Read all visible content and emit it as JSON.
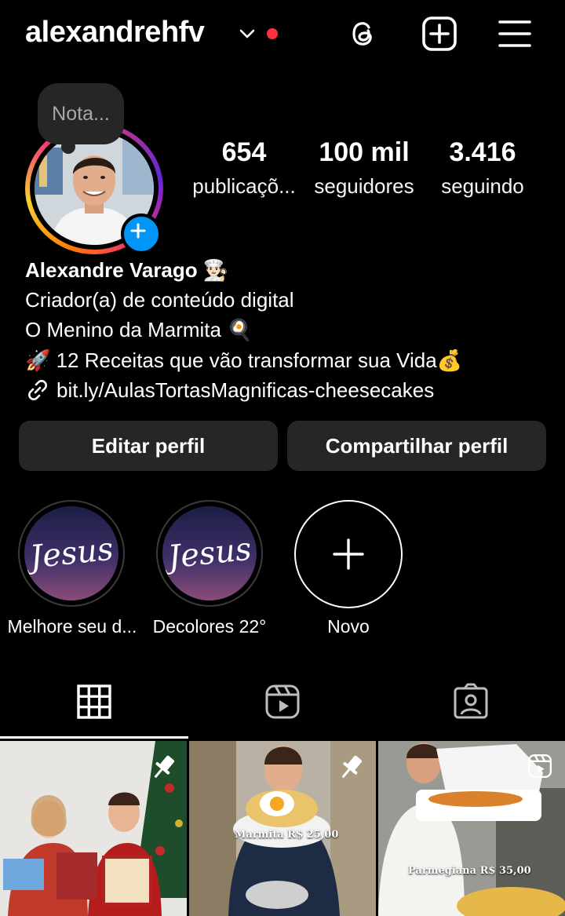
{
  "header": {
    "username": "alexandrehfv",
    "icons": [
      "chevron-down-icon",
      "threads-icon",
      "new-post-icon",
      "menu-icon"
    ]
  },
  "note": {
    "text": "Nota..."
  },
  "stats": [
    {
      "value": "654",
      "label": "publicaçõ..."
    },
    {
      "value": "100 mil",
      "label": "seguidores"
    },
    {
      "value": "3.416",
      "label": "seguindo"
    }
  ],
  "bio": {
    "name": "Alexandre Varago 👨🏻‍🍳",
    "category": "Criador(a) de conteúdo digital",
    "line1": "O Menino da Marmita 🍳",
    "line2": "🚀 12 Receitas que vão transformar sua Vida💰",
    "link": "bit.ly/AulasTortasMagnificas-cheesecakes"
  },
  "buttons": {
    "edit": "Editar perfil",
    "share": "Compartilhar perfil"
  },
  "highlights": [
    {
      "label": "Melhore seu d...",
      "cover_text": "Jesus"
    },
    {
      "label": "Decolores 22°",
      "cover_text": "Jesus"
    },
    {
      "label": "Novo"
    }
  ],
  "tabs": [
    "grid-icon",
    "reels-icon",
    "tagged-icon"
  ],
  "posts": [
    {
      "overlay": "",
      "badge": "pin-icon"
    },
    {
      "overlay": "Marmita R$ 25,00",
      "badge": "pin-icon"
    },
    {
      "overlay": "Parmegiana R$ 35,00",
      "badge": "reels-icon"
    }
  ],
  "colors": {
    "accent": "#0095f6",
    "notification": "#ff3040",
    "button_bg": "#262626"
  }
}
